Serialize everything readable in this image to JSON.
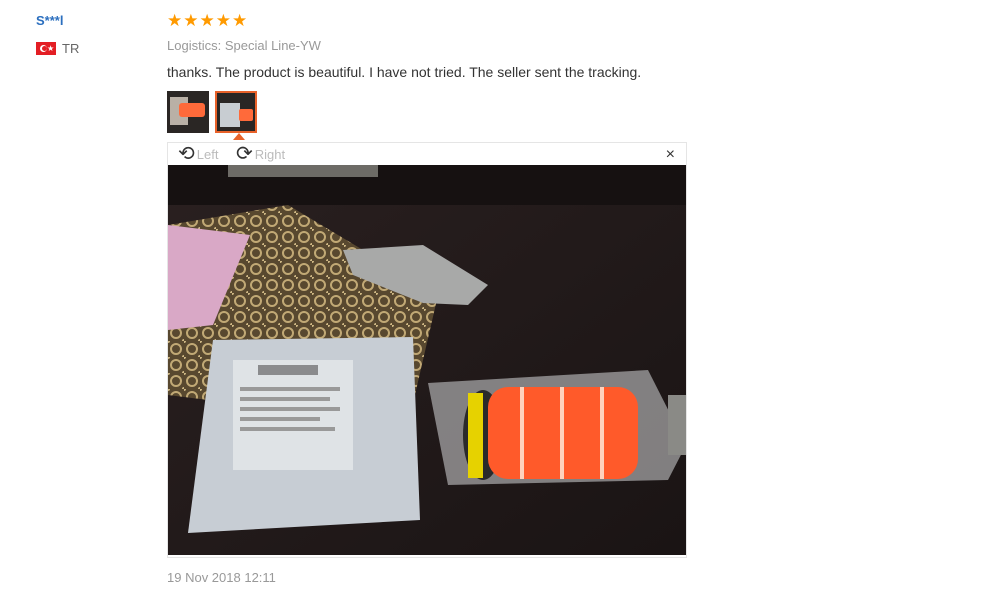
{
  "reviewer": {
    "name": "S***l",
    "country_code": "TR"
  },
  "rating": {
    "stars": 5,
    "max": 5,
    "star_glyph": "★",
    "color": "#ff9a00"
  },
  "logistics": {
    "label": "Logistics:",
    "value": "Special Line-YW"
  },
  "review": {
    "text": "thanks. The product is beautiful. I have not tried. The seller sent the tracking."
  },
  "thumbnails": {
    "count": 2,
    "selected_index": 1,
    "accent_color": "#e8622a"
  },
  "viewer": {
    "rotate_left_label": "Left",
    "rotate_right_label": "Right",
    "rotate_left_icon": "rotate-left-icon",
    "rotate_right_icon": "rotate-right-icon",
    "close_icon": "close-icon",
    "close_glyph": "×"
  },
  "date": "19 Nov 2018 12:11"
}
